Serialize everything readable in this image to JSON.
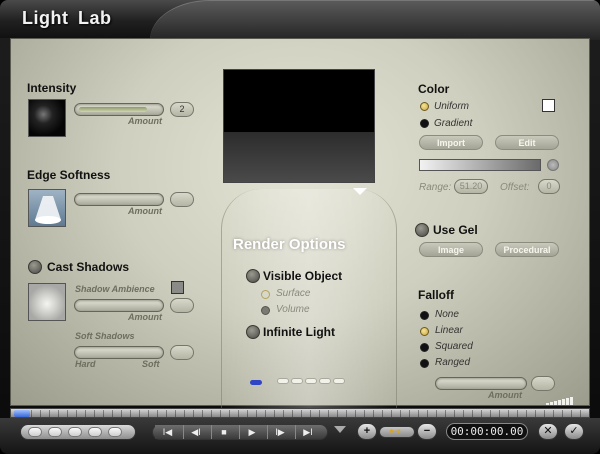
{
  "window": {
    "title": "Light Lab"
  },
  "intensity": {
    "label": "Intensity",
    "amount_label": "Amount",
    "value": "2",
    "level": 0.85
  },
  "edge_softness": {
    "label": "Edge Softness",
    "amount_label": "Amount",
    "value": ""
  },
  "cast_shadows": {
    "label": "Cast Shadows",
    "shadow_ambience_label": "Shadow Ambience",
    "amount_label": "Amount",
    "soft_shadows_label": "Soft Shadows",
    "hard_label": "Hard",
    "soft_label": "Soft"
  },
  "render_options": {
    "title": "Render Options",
    "visible_object": "Visible Object",
    "surface": "Surface",
    "volume": "Volume",
    "infinite_light": "Infinite Light"
  },
  "color": {
    "label": "Color",
    "uniform": "Uniform",
    "gradient": "Gradient",
    "import": "Import",
    "edit": "Edit",
    "range_label": "Range:",
    "range_value": "51.20",
    "offset_label": "Offset:",
    "offset_value": "0",
    "swatch": "#ffffff"
  },
  "gel": {
    "label": "Use Gel",
    "image": "Image",
    "procedural": "Procedural"
  },
  "falloff": {
    "label": "Falloff",
    "none": "None",
    "linear": "Linear",
    "squared": "Squared",
    "ranged": "Ranged",
    "amount_label": "Amount"
  },
  "transport": {
    "timecode": "00:00:00.00",
    "first": "I◀",
    "prev": "◀I",
    "stop": "■",
    "play": "▶",
    "next": "I▶",
    "last": "▶I",
    "plus": "+",
    "minus": "−",
    "key": "⊷",
    "close": "✕",
    "confirm": "✓"
  }
}
